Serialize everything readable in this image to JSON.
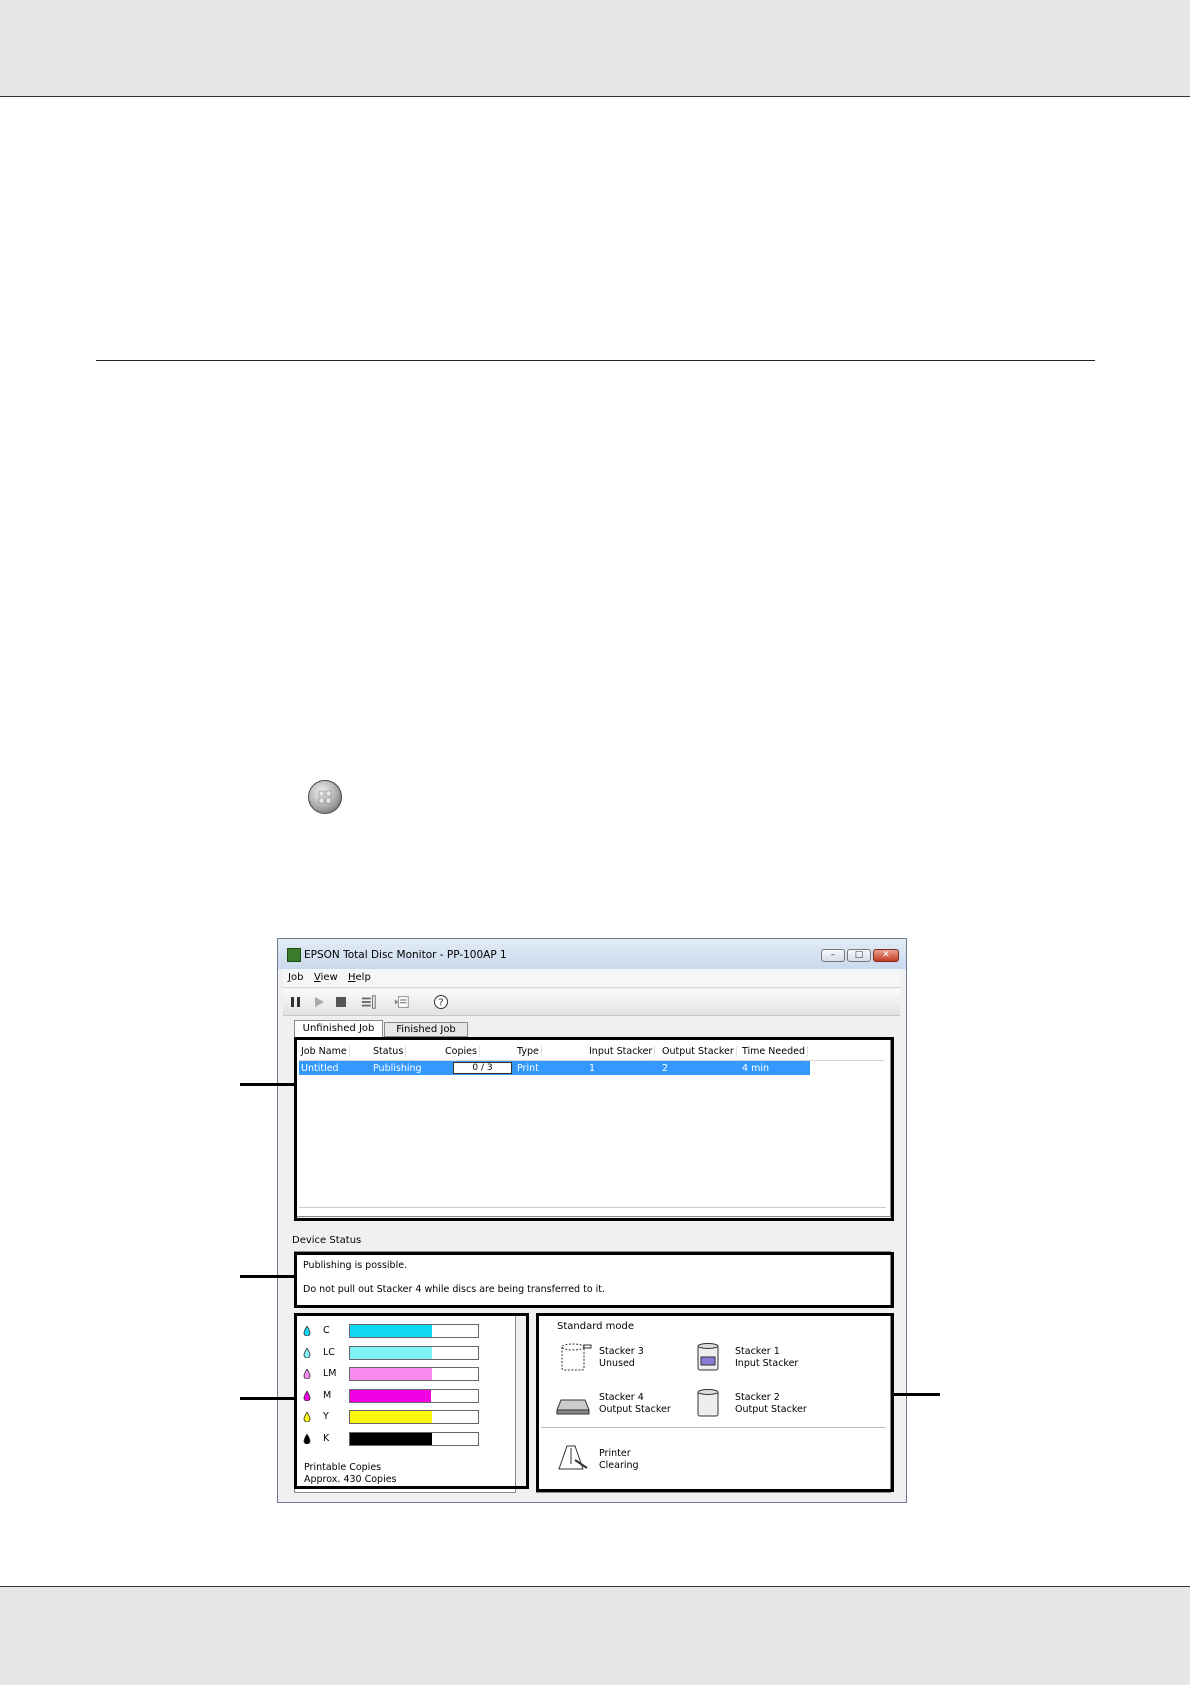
{
  "window": {
    "title": "EPSON Total Disc Monitor - PP-100AP 1",
    "controls": {
      "minimize": "–",
      "maximize": "□",
      "close": "✕"
    },
    "menu": [
      "Job",
      "View",
      "Help"
    ],
    "toolbar_icons": [
      "pause-icon",
      "play-icon",
      "stop-icon",
      "job-list-icon",
      "job-detail-icon",
      "help-icon"
    ]
  },
  "tabs": [
    "Unfinished Job",
    "Finished Job"
  ],
  "jobs": {
    "columns": [
      "Job Name",
      "Status",
      "Copies",
      "Type",
      "Input Stacker",
      "Output Stacker",
      "Time Needed"
    ],
    "rows": [
      {
        "job_name": "Untitled",
        "status": "Publishing",
        "copies": "0 / 3",
        "type": "Print",
        "input_stacker": "1",
        "output_stacker": "2",
        "time_needed": "4 min"
      }
    ]
  },
  "device_status": {
    "label": "Device Status",
    "messages": [
      "Publishing is possible.",
      "Do not pull out Stacker 4 while discs are being transferred to it."
    ]
  },
  "ink": {
    "levels": [
      {
        "name": "C",
        "color": "#10d8f4",
        "level": 0.64
      },
      {
        "name": "LC",
        "color": "#7ff1f7",
        "level": 0.64
      },
      {
        "name": "LM",
        "color": "#f98af0",
        "level": 0.64
      },
      {
        "name": "M",
        "color": "#f000e2",
        "level": 0.63
      },
      {
        "name": "Y",
        "color": "#fbf50f",
        "level": 0.64
      },
      {
        "name": "K",
        "color": "#000000",
        "level": 0.64
      }
    ],
    "printable_label": "Printable Copies",
    "printable_value": "Approx. 430 Copies"
  },
  "stackers": {
    "mode": "Standard mode",
    "items": [
      {
        "name": "Stacker 3",
        "state": "Unused",
        "icon": "stacker-empty-icon"
      },
      {
        "name": "Stacker 1",
        "state": "Input Stacker",
        "icon": "stacker-discs-icon"
      },
      {
        "name": "Stacker 4",
        "state": "Output Stacker",
        "icon": "stacker-tray-icon"
      },
      {
        "name": "Stacker 2",
        "state": "Output Stacker",
        "icon": "stacker-bin-icon"
      }
    ],
    "printer": {
      "name": "Printer",
      "state": "Clearing",
      "icon": "printer-cleaning-icon"
    }
  }
}
